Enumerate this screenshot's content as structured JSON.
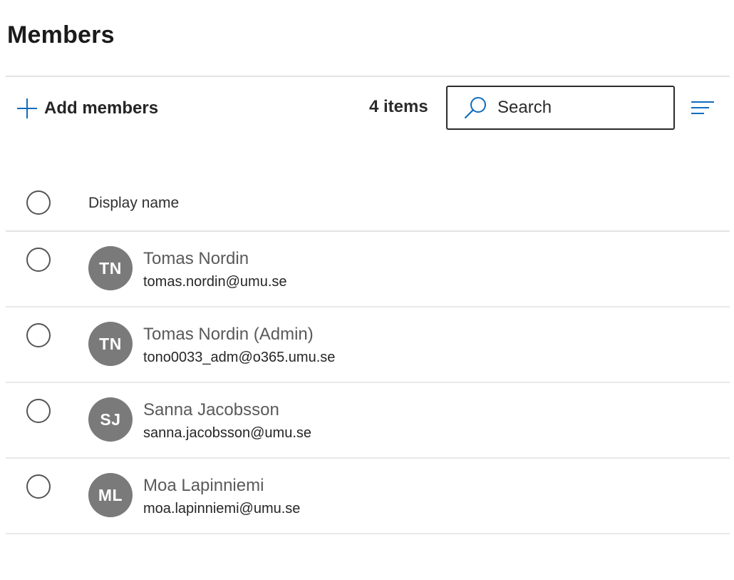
{
  "page": {
    "title": "Members"
  },
  "toolbar": {
    "add_label": "Add members",
    "item_count": "4 items",
    "search_placeholder": "Search"
  },
  "table": {
    "column_header": "Display name",
    "rows": [
      {
        "initials": "TN",
        "name": "Tomas Nordin",
        "email": "tomas.nordin@umu.se"
      },
      {
        "initials": "TN",
        "name": "Tomas Nordin (Admin)",
        "email": "tono0033_adm@o365.umu.se"
      },
      {
        "initials": "SJ",
        "name": "Sanna Jacobsson",
        "email": "sanna.jacobsson@umu.se"
      },
      {
        "initials": "ML",
        "name": "Moa Lapinniemi",
        "email": "moa.lapinniemi@umu.se"
      }
    ]
  },
  "icons": {
    "add": "plus-icon",
    "search": "search-icon",
    "filter": "filter-icon"
  },
  "colors": {
    "accent": "#0f6cbd",
    "avatar": "#7a7a7a",
    "divider": "#e3e3e3"
  }
}
